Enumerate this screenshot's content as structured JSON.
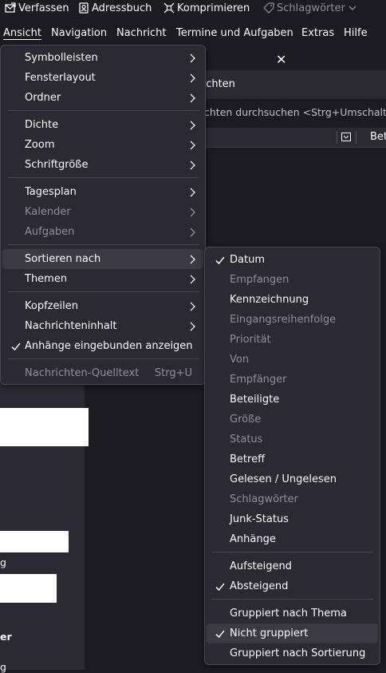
{
  "toolbar": {
    "compose": "Verfassen",
    "addressbook": "Adressbuch",
    "compact": "Komprimieren",
    "tags": "Schlagwörter"
  },
  "menubar": {
    "view": "Ansicht",
    "navigation": "Navigation",
    "message": "Nachricht",
    "events": "Termine und Aufgaben",
    "extras": "Extras",
    "help": "Hilfe"
  },
  "background": {
    "header_text": "hrichten",
    "search_placeholder": "chten durchsuchen <Strg+Umschalt+",
    "col_subject": "Bet",
    "close": "✕",
    "left_text_1": "g",
    "left_text_2": "er",
    "left_text_3": "g"
  },
  "view_menu": {
    "toolbars": "Symbolleisten",
    "layout": "Fensterlayout",
    "folders": "Ordner",
    "density": "Dichte",
    "zoom": "Zoom",
    "fontsize": "Schriftgröße",
    "today": "Tagesplan",
    "calendar": "Kalender",
    "tasks": "Aufgaben",
    "sort_by": "Sortieren nach",
    "threads": "Themen",
    "headers": "Kopfzeilen",
    "body": "Nachrichteninhalt",
    "attachments_inline": "Anhänge eingebunden anzeigen",
    "source": "Nachrichten-Quelltext",
    "source_shortcut": "Strg+U"
  },
  "sort_menu": {
    "date": "Datum",
    "received": "Empfangen",
    "flag": "Kennzeichnung",
    "order_received": "Eingangsreihenfolge",
    "priority": "Priorität",
    "from": "Von",
    "recipient": "Empfänger",
    "correspondents": "Beteiligte",
    "size": "Größe",
    "status": "Status",
    "subject": "Betreff",
    "read": "Gelesen / Ungelesen",
    "tags": "Schlagwörter",
    "junk": "Junk-Status",
    "attachments": "Anhänge",
    "ascending": "Aufsteigend",
    "descending": "Absteigend",
    "grouped_thread": "Gruppiert nach Thema",
    "not_grouped": "Nicht gruppiert",
    "grouped_sort": "Gruppiert nach Sortierung"
  },
  "colors": {
    "background": "#1c1b22",
    "menu_bg": "#2b2a33",
    "text": "#fbfbfe",
    "disabled": "#8f8f9d"
  }
}
